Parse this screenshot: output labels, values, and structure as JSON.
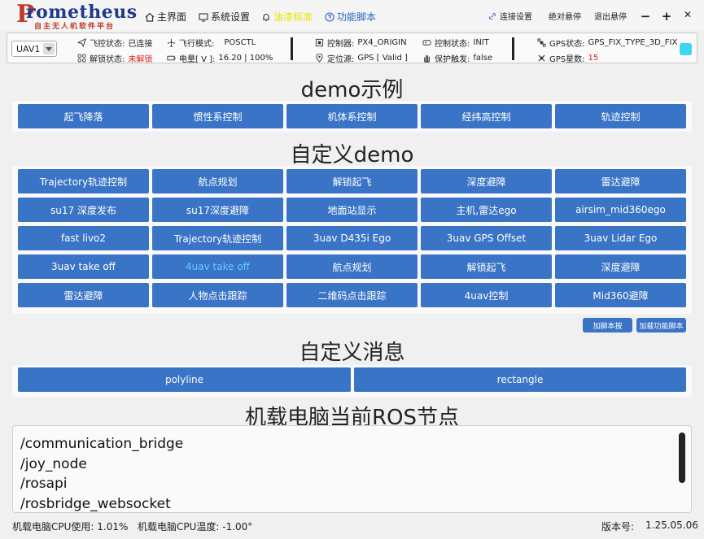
{
  "brand": {
    "name": "rometheus",
    "initial": "P",
    "subtitle": "自主无人机软件平台"
  },
  "nav": {
    "home": "主界面",
    "settings": "系统设置",
    "alert": "油漆标准",
    "script": "功能脚本",
    "connect": "连接设置",
    "fullscreen": "绝对悬停",
    "exit": "退出悬停"
  },
  "window": {
    "minimize": "−",
    "maximize": "+",
    "close": "✕"
  },
  "status": {
    "uav": "UAV1",
    "fc_state_label": "飞控状态:",
    "fc_state": "已连接",
    "fly_mode_label": "飞行模式:",
    "fly_mode": "POSCTL",
    "unlock_label": "解锁状态:",
    "unlock": "未解锁",
    "battery_label": "电量[ V ]:",
    "battery": "16.20 | 100%",
    "controller_label": "控制器:",
    "controller": "PX4_ORIGIN",
    "ctrl_state_label": "控制状态:",
    "ctrl_state": "INIT",
    "loc_label": "定位源:",
    "loc": "GPS [ Valid ]",
    "protect_label": "保护触发:",
    "protect": "false",
    "gps_state_label": "GPS状态:",
    "gps_state": "GPS_FIX_TYPE_3D_FIX",
    "gps_num_label": "GPS星数:",
    "gps_num": "15"
  },
  "demo": {
    "title": "demo示例",
    "buttons": [
      "起飞降落",
      "惯性系控制",
      "机体系控制",
      "经纬高控制",
      "轨迹控制"
    ]
  },
  "custom_demo": {
    "title": "自定义demo",
    "rows": [
      [
        "Trajectory轨迹控制",
        "航点规划",
        "解锁起飞",
        "深度避障",
        "雷达避障"
      ],
      [
        "su17 深度发布",
        "su17深度避障",
        "地面站显示",
        "主机,雷达ego",
        "airsim_mid360ego"
      ],
      [
        "fast livo2",
        "Trajectory轨迹控制",
        "3uav D435i Ego",
        "3uav GPS Offset",
        "3uav Lidar Ego"
      ],
      [
        "3uav take off",
        "4uav take off",
        "航点规划",
        "解锁起飞",
        "深度避障"
      ],
      [
        "雷达避障",
        "人物点击跟踪",
        "二维码点击跟踪",
        "4uav控制",
        "Mid360避障"
      ]
    ],
    "add_script": "加脚本按",
    "load_script": "加载功能脚本"
  },
  "custom_msg": {
    "title": "自定义消息",
    "buttons": [
      "polyline",
      "rectangle"
    ]
  },
  "ros": {
    "title": "机载电脑当前ROS节点",
    "nodes": [
      "/communication_bridge",
      "/joy_node",
      "/rosapi",
      "/rosbridge_websocket"
    ]
  },
  "footer": {
    "cpu_usage": "机载电脑CPU使用: 1.01%",
    "cpu_temp": "机载电脑CPU温度: -1.00°",
    "version_label": "版本号:",
    "version": "1.25.05.06"
  },
  "colors": {
    "button": "#3a74c6",
    "accent": "#3dd6f0",
    "alert": "#e6e600",
    "warn": "#e02020"
  }
}
